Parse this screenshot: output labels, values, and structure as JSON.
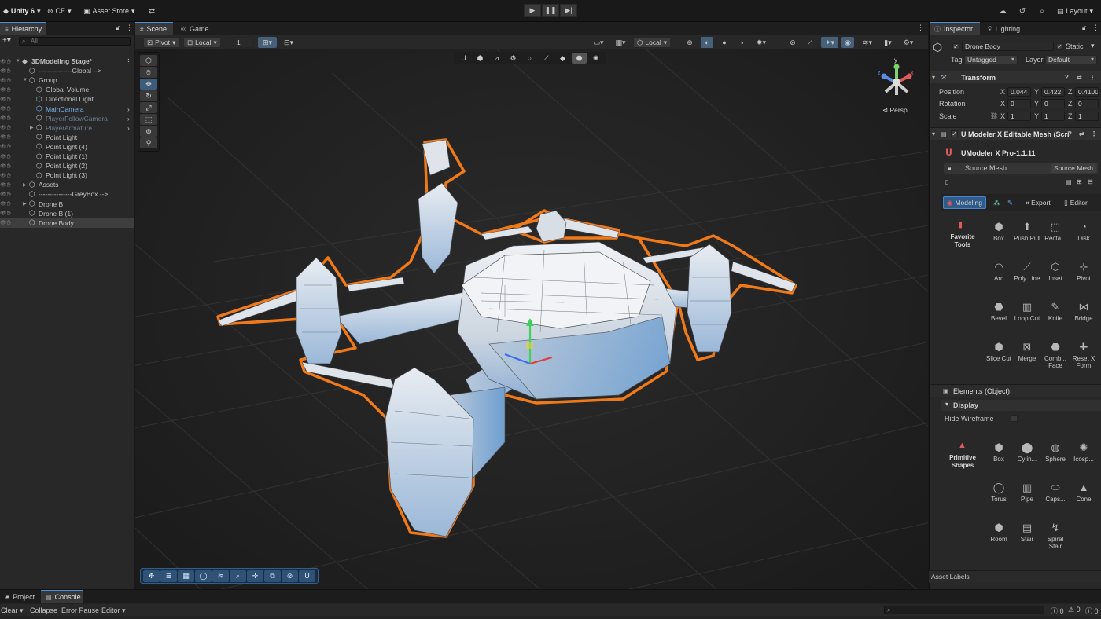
{
  "topbar": {
    "account": "Unity 6",
    "cloud": "CE",
    "asset_store": "Asset Store",
    "layout": "Layout"
  },
  "hierarchy": {
    "tab": "Hierarchy",
    "search_placeholder": "All",
    "items": [
      {
        "label": "3DModeling Stage*",
        "depth": 0,
        "style": "scene"
      },
      {
        "label": "---------------Global -->",
        "depth": 1,
        "style": "normal"
      },
      {
        "label": "Group",
        "depth": 1,
        "style": "normal"
      },
      {
        "label": "Global Volume",
        "depth": 2,
        "style": "normal"
      },
      {
        "label": "Directional Light",
        "depth": 2,
        "style": "normal"
      },
      {
        "label": "MainCamera",
        "depth": 2,
        "style": "blue"
      },
      {
        "label": "PlayerFollowCamera",
        "depth": 2,
        "style": "dim"
      },
      {
        "label": "PlayerArmature",
        "depth": 2,
        "style": "dim"
      },
      {
        "label": "Point Light",
        "depth": 2,
        "style": "normal"
      },
      {
        "label": "Point Light (4)",
        "depth": 2,
        "style": "normal"
      },
      {
        "label": "Point Light (1)",
        "depth": 2,
        "style": "normal"
      },
      {
        "label": "Point Light (2)",
        "depth": 2,
        "style": "normal"
      },
      {
        "label": "Point Light (3)",
        "depth": 2,
        "style": "normal"
      },
      {
        "label": "Assets",
        "depth": 1,
        "style": "normal"
      },
      {
        "label": "---------------GreyBox -->",
        "depth": 1,
        "style": "normal"
      },
      {
        "label": "Drone B",
        "depth": 1,
        "style": "normal"
      },
      {
        "label": "Drone B (1)",
        "depth": 1,
        "style": "normal"
      },
      {
        "label": "Drone Body",
        "depth": 1,
        "style": "selected"
      }
    ]
  },
  "scene": {
    "tab_scene": "Scene",
    "tab_game": "Game",
    "pivot": "Pivot",
    "local": "Local",
    "grid_value": "1",
    "local2": "Local",
    "persp": "Persp"
  },
  "inspector": {
    "tab_inspector": "Inspector",
    "tab_lighting": "Lighting",
    "object_name": "Drone Body",
    "static_label": "Static",
    "tag_label": "Tag",
    "tag_value": "Untagged",
    "layer_label": "Layer",
    "layer_value": "Default",
    "transform": {
      "title": "Transform",
      "position_label": "Position",
      "rotation_label": "Rotation",
      "scale_label": "Scale",
      "position": {
        "x": "0.044",
        "y": "0.422",
        "z": "0.4100"
      },
      "rotation": {
        "x": "0",
        "y": "0",
        "z": "0"
      },
      "scale": {
        "x": "1",
        "y": "1",
        "z": "1"
      }
    },
    "umodeler": {
      "title": "U Modeler X Editable Mesh (Scri",
      "product": "UModeler X Pro-1.1.11",
      "source_mesh_label": "Source Mesh",
      "source_mesh_value": "Source Mesh",
      "mode_modeling": "Modeling",
      "mode_export": "Export",
      "mode_editor": "Editor",
      "favorite_tools": "Favorite Tools",
      "tools": [
        [
          "Box",
          "Push Pull",
          "Recta...",
          "Disk"
        ],
        [
          "Arc",
          "Poly Line",
          "Inset",
          "Pivot"
        ],
        [
          "Bevel",
          "Loop Cut",
          "Knife",
          "Bridge"
        ],
        [
          "Slice Cut",
          "Merge",
          "Comb... Face",
          "Reset X Form"
        ]
      ],
      "elements_title": "Elements (Object)",
      "display_title": "Display",
      "hide_wireframe": "Hide Wireframe",
      "primitive_shapes": "Primitive Shapes",
      "primitives": [
        [
          "Box",
          "Cylin...",
          "Sphere",
          "Icosp..."
        ],
        [
          "Torus",
          "Pipe",
          "Caps...",
          "Cone"
        ],
        [
          "Room",
          "Stair",
          "Spiral Stair"
        ]
      ]
    },
    "asset_labels": "Asset Labels"
  },
  "bottom": {
    "tab_project": "Project",
    "tab_console": "Console",
    "clear": "Clear",
    "collapse": "Collapse",
    "error_pause": "Error Pause",
    "editor": "Editor",
    "count_info": "0",
    "count_warn": "0",
    "count_error": "0"
  },
  "colors": {
    "selection_outline": "#f07a1a",
    "accent_blue": "#2f5b8a",
    "mesh_light": "#e4e8ee",
    "mesh_blue": "#8fb8e0"
  }
}
